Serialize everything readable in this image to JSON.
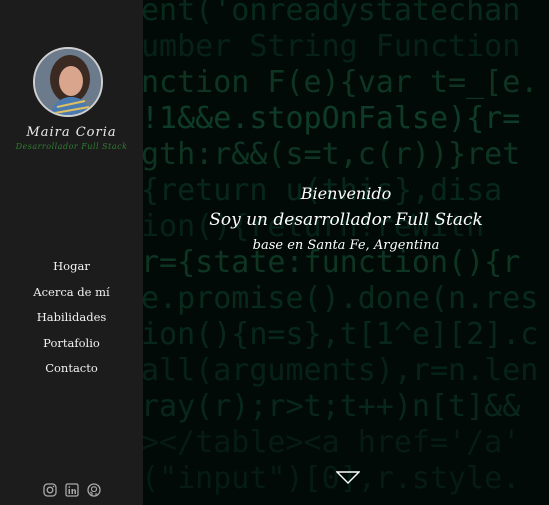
{
  "profile": {
    "name": "Maira Coria",
    "role": "Desarrollador Full Stack"
  },
  "nav": {
    "items": [
      {
        "label": "Hogar"
      },
      {
        "label": "Acerca de mí"
      },
      {
        "label": "Habilidades"
      },
      {
        "label": "Portafolio"
      },
      {
        "label": "Contacto"
      }
    ]
  },
  "social": {
    "icons": [
      "instagram-icon",
      "linkedin-icon",
      "github-icon"
    ]
  },
  "hero": {
    "greeting": "Bienvenido",
    "headline": "Soy un desarrollador Full Stack",
    "location": "base en Santa Fe, Argentina"
  },
  "colors": {
    "sidebar_bg": "#1c1c1c",
    "accent": "#2e7d32",
    "code_green": "#0f5a3a"
  }
}
